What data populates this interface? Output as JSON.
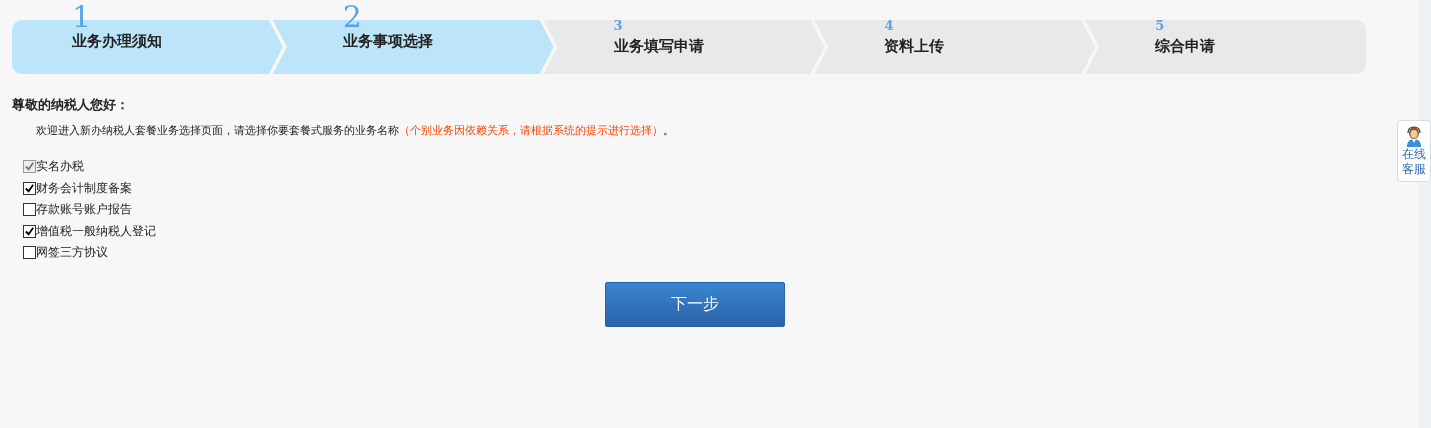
{
  "steps": [
    {
      "number": "1",
      "label": "业务办理须知",
      "active": true
    },
    {
      "number": "2",
      "label": "业务事项选择",
      "active": true
    },
    {
      "number": "3",
      "label": "业务填写申请",
      "active": false
    },
    {
      "number": "4",
      "label": "资料上传",
      "active": false
    },
    {
      "number": "5",
      "label": "综合申请",
      "active": false
    }
  ],
  "greeting": "尊敬的纳税人您好：",
  "intro": "欢迎进入新办纳税人套餐业务选择页面，请选择你要套餐式服务的业务名称",
  "intro_note": "（个别业务因依赖关系，请根据系统的提示进行选择）",
  "intro_end": "。",
  "options": [
    {
      "label": "实名办税",
      "checked": true,
      "disabled": true
    },
    {
      "label": "财务会计制度备案",
      "checked": true,
      "disabled": false
    },
    {
      "label": "存款账号账户报告",
      "checked": false,
      "disabled": false
    },
    {
      "label": "增值税一般纳税人登记",
      "checked": true,
      "disabled": false
    },
    {
      "label": "网签三方协议",
      "checked": false,
      "disabled": false
    }
  ],
  "next_button": "下一步",
  "online_service": {
    "label": "在线客服"
  }
}
